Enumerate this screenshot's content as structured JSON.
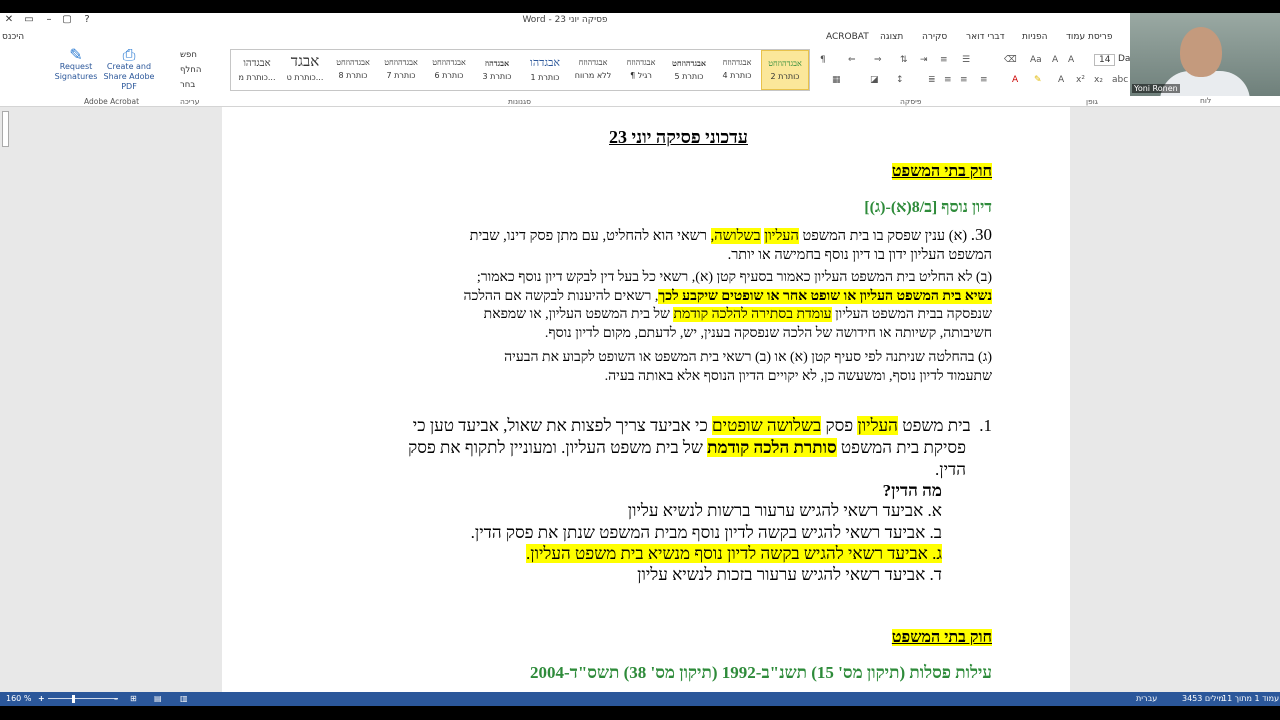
{
  "window": {
    "title": "פסיקה יוני 23 - Word",
    "controls": [
      "?",
      "▭",
      "–",
      "▢",
      "✕"
    ]
  },
  "account": {
    "signin": "היכנס"
  },
  "tabs": [
    "פריסת עמוד",
    "הפניות",
    "דברי דואר",
    "סקירה",
    "תצוגה",
    "ACROBAT"
  ],
  "ribbon": {
    "groups": {
      "font": "גופן",
      "paragraph": "פיסקה",
      "styles": "סגנונות",
      "editing": "עריכה",
      "adobe": "Adobe Acrobat",
      "clipboard": "לוח"
    },
    "font_size": "14",
    "font_name": "Da",
    "styles": [
      {
        "sample": "אבגדהוזחט",
        "label": "כותרת 2",
        "selected": true
      },
      {
        "sample": "אבגדהוזח",
        "label": "כותרת 4",
        "selected": false
      },
      {
        "sample": "אבגדהוזחט",
        "label": "כותרת 5",
        "selected": false
      },
      {
        "sample": "אבגדהוזח",
        "label": "¶ רגיל",
        "selected": false
      },
      {
        "sample": "אבגדהוזח",
        "label": "ללא מרווח",
        "selected": false
      },
      {
        "sample": "אבגדהו",
        "label": "כותרת 1",
        "selected": false
      },
      {
        "sample": "אבגדהוז",
        "label": "כותרת 3",
        "selected": false
      },
      {
        "sample": "אבגדהוזחט",
        "label": "כותרת 6",
        "selected": false
      },
      {
        "sample": "אבגדהוזחט",
        "label": "כותרת 7",
        "selected": false
      },
      {
        "sample": "אבגדהוזחט",
        "label": "כותרת 8",
        "selected": false
      },
      {
        "sample": "אבגד",
        "label": "כותרת ט...",
        "selected": false
      },
      {
        "sample": "אבגדהו",
        "label": "כותרת מ...",
        "selected": false
      }
    ],
    "editing": [
      "חפש",
      "החלף",
      "בחר"
    ],
    "adobe": [
      {
        "label": "Request Signatures",
        "icon": "signature-icon"
      },
      {
        "label": "Create and Share Adobe PDF",
        "icon": "pdf-icon"
      }
    ]
  },
  "webcam": {
    "name": "Yoni Ronen"
  },
  "document": {
    "title": "עדכוני פסיקה יוני 23",
    "heading1": "חוק בתי המשפט",
    "sub1": "דיון נוסף [ב/8(א)-(ג)]",
    "p30_num": "30.",
    "p30a_pre": "(א)  ענין שפסק בו בית המשפט ",
    "p30a_hl1": "העליון",
    "p30a_sp": " ",
    "p30a_hl2": "בשלושה,",
    "p30a_post": " רשאי הוא להחליט, עם מתן פסק דינו, שבית",
    "p30a_line2": "המשפט העליון ידון בו דיון נוסף בחמישה או יותר.",
    "p30b_line1": "(ב)  לא החליט בית המשפט העליון כאמור בסעיף קטן (א), רשאי כל בעל דין לבקש דיון נוסף כאמור;",
    "p30b_hl": "נשיא בית המשפט העליון או שופט אחר או שופטים שיקבע לכך",
    "p30b_line2_post": ", רשאים להיענות לבקשה אם ההלכה",
    "p30b_line3_pre": "שנפסקה בבית המשפט העליון ",
    "p30b_line3_hl": "עומדת בסתירה להלכה קודמת",
    "p30b_line3_post": " של בית המשפט העליון, או שמפאת",
    "p30b_line4": "חשיבותה, קשיותה או חידושה של הלכה שנפסקה בענין, יש, לדעתם, מקום לדיון נוסף.",
    "p30c_line1": "(ג)  בהחלטה שניתנה לפי סעיף קטן (א) או (ב) רשאי בית המשפט או השופט לקבוע את הבעיה",
    "p30c_line2": "שתעמוד לדיון נוסף, ומשעשה כן, לא יקויים הדיון הנוסף אלא באותה בעיה.",
    "q1_num": "1.",
    "q1_pre": "בית משפט ",
    "q1_hl1": "העליון",
    "q1_mid1": " פסק ",
    "q1_hl2": "בשלושה שופטים",
    "q1_post": " כי אביעד צריך לפצות את שאול, אביעד טען כי",
    "q1_line2_pre": "פסיקת בית המשפט ",
    "q1_line2_hl": "סותרת הלכה קודמת",
    "q1_line2_post": " של בית משפט העליון. ומעוניין לתקוף את פסק",
    "q1_line3": "הדין.",
    "question": "מה הדין?",
    "opt_a": "א.  אביעד רשאי להגיש ערעור ברשות לנשיא עליון",
    "opt_b": "ב.  אביעד רשאי להגיש בקשה לדיון נוסף מבית המשפט שנתן את פסק הדין.",
    "opt_c": "ג.  אביעד רשאי להגיש בקשה לדיון נוסף מנשיא בית משפט העליון.",
    "opt_d": "ד.  אביעד רשאי להגיש ערעור בזכות לנשיא עליון",
    "heading2": "חוק בתי המשפט",
    "sub2": "עילות פסלות (תיקון מס' 15) תשנ\"ב-1992 (תיקון מס' 38) תשס\"ד-2004"
  },
  "status": {
    "page": "עמוד 1 מתוך 11",
    "words": "3453 מילים",
    "language": "עברית",
    "zoom": "160 %"
  },
  "colors": {
    "highlight": "#ffff00",
    "green_heading": "#2e8b3a",
    "statusbar": "#2b579a"
  }
}
